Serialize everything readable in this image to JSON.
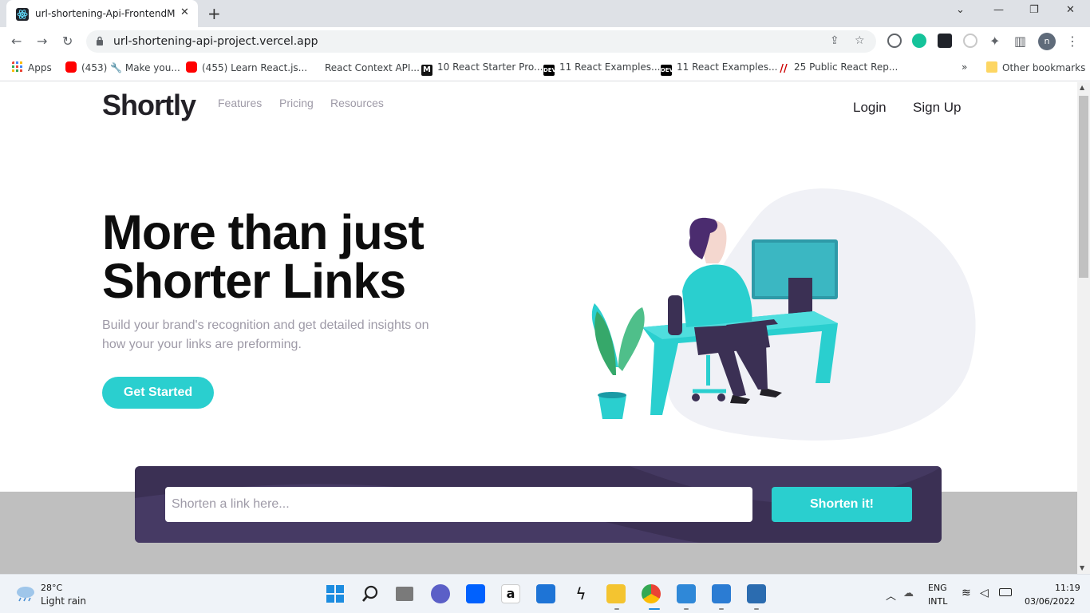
{
  "browser": {
    "tab_title": "url-shortening-Api-FrontendMen",
    "url": "url-shortening-api-project.vercel.app",
    "profile_initial": "n",
    "bookmarks": [
      {
        "label": "Apps",
        "icon": "apps-grid-icon"
      },
      {
        "label": "(453) 🔧 Make you...",
        "icon": "youtube-icon"
      },
      {
        "label": "(455) Learn React.js...",
        "icon": "youtube-icon"
      },
      {
        "label": "React Context API...",
        "icon": "blank-icon"
      },
      {
        "label": "10 React Starter Pro...",
        "icon": "medium-icon"
      },
      {
        "label": "11 React Examples...",
        "icon": "dev-icon"
      },
      {
        "label": "11 React Examples...",
        "icon": "dev-icon"
      },
      {
        "label": "25 Public React Rep...",
        "icon": "slash-icon"
      }
    ],
    "other_bookmarks": "Other bookmarks",
    "overflow": "»"
  },
  "page": {
    "logo": "Shortly",
    "nav": [
      "Features",
      "Pricing",
      "Resources"
    ],
    "login": "Login",
    "signup": "Sign Up",
    "headline": "More than just Shorter Links",
    "subline": "Build your brand's recognition and get detailed insights on how your your links are preforming.",
    "cta": "Get Started",
    "shorten": {
      "placeholder": "Shorten a link here...",
      "button": "Shorten it!"
    }
  },
  "taskbar": {
    "temperature": "28°C",
    "condition": "Light rain",
    "lang": "ENG",
    "layout": "INTL",
    "time": "11:19",
    "date": "03/06/2022"
  },
  "colors": {
    "cyan": "#2acfcf",
    "dark_violet": "#3b3054",
    "grayish_violet": "#9e9aa7"
  }
}
